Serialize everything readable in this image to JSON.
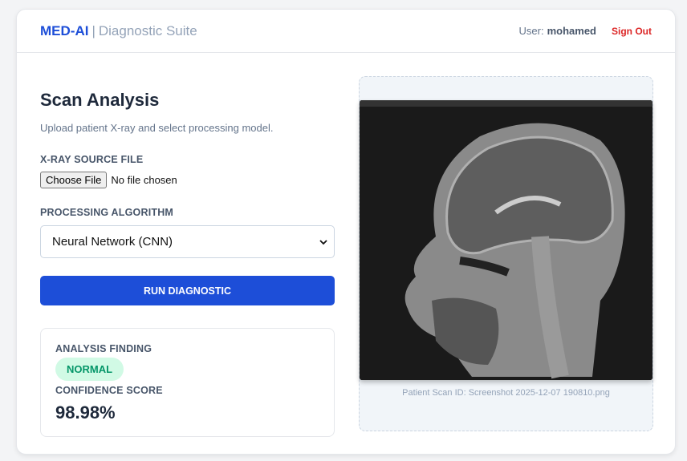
{
  "header": {
    "brand": "MED-AI",
    "separator": "|",
    "suite": "Diagnostic Suite",
    "user_label": "User:",
    "username": "mohamed",
    "sign_out": "Sign Out"
  },
  "main": {
    "title": "Scan Analysis",
    "subtitle": "Upload patient X-ray and select processing model.",
    "file_label": "X-RAY SOURCE FILE",
    "choose_file": "Choose File",
    "no_file": "No file chosen",
    "algorithm_label": "PROCESSING ALGORITHM",
    "algorithm_value": "Neural Network (CNN)",
    "run_button": "RUN DIAGNOSTIC"
  },
  "result": {
    "finding_label": "ANALYSIS FINDING",
    "finding": "NORMAL",
    "confidence_label": "CONFIDENCE SCORE",
    "confidence": "98.98%"
  },
  "preview": {
    "scan_id": "Patient Scan ID: Screenshot 2025-12-07 190810.png"
  },
  "colors": {
    "accent": "#1d4ed8",
    "danger": "#dc2626",
    "success": "#059669"
  }
}
